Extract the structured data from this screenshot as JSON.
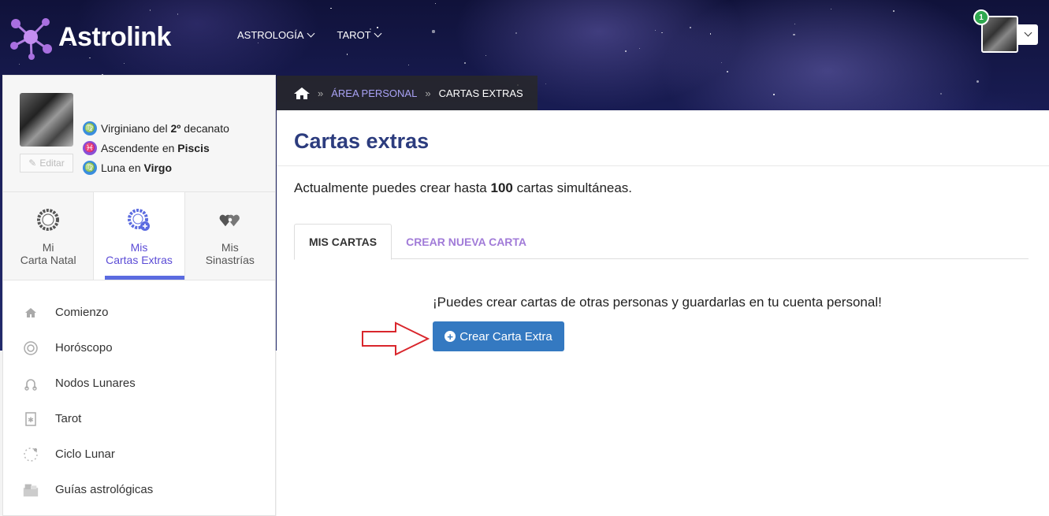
{
  "header": {
    "logo_text": "Astrolink",
    "nav": [
      {
        "label": "ASTROLOGÍA"
      },
      {
        "label": "TAROT"
      }
    ],
    "notification_count": "1"
  },
  "profile": {
    "edit_label": "Editar",
    "signs": [
      {
        "glyph": "♍",
        "prefix": "Virginiano del ",
        "strong": "2º",
        "suffix": " decanato",
        "color": "#3a8dde"
      },
      {
        "glyph": "♓",
        "prefix": "Ascendente en ",
        "strong": "Piscis",
        "suffix": "",
        "color": "#8a4fd6"
      },
      {
        "glyph": "♍",
        "prefix": "Luna en ",
        "strong": "Virgo",
        "suffix": "",
        "color": "#3a8dde"
      }
    ]
  },
  "sidebar_tabs": [
    {
      "line1": "Mi",
      "line2": "Carta Natal",
      "icon": "natal-chart-icon"
    },
    {
      "line1": "Mis",
      "line2": "Cartas Extras",
      "icon": "extra-charts-icon"
    },
    {
      "line1": "Mis",
      "line2": "Sinastrías",
      "icon": "hearts-icon"
    }
  ],
  "menu": [
    {
      "label": "Comienzo",
      "icon": "home-icon"
    },
    {
      "label": "Horóscopo",
      "icon": "horoscope-icon"
    },
    {
      "label": "Nodos Lunares",
      "icon": "lunar-nodes-icon"
    },
    {
      "label": "Tarot",
      "icon": "tarot-card-icon"
    },
    {
      "label": "Ciclo Lunar",
      "icon": "moon-cycle-icon"
    },
    {
      "label": "Guías astrológicas",
      "icon": "guides-icon"
    }
  ],
  "breadcrumb": {
    "link": "ÁREA PERSONAL",
    "current": "CARTAS EXTRAS"
  },
  "main": {
    "title": "Cartas extras",
    "desc_prefix": "Actualmente puedes crear hasta ",
    "desc_strong": "100",
    "desc_suffix": " cartas simultáneas.",
    "tabs": [
      {
        "label": "MIS CARTAS"
      },
      {
        "label": "CREAR NUEVA CARTA"
      }
    ],
    "promo": "¡Puedes crear cartas de otras personas y guardarlas en tu cuenta personal!",
    "create_button": "Crear Carta Extra"
  },
  "colors": {
    "accent": "#5b6be0",
    "title": "#2c3c7e",
    "button": "#3479c1",
    "arrow": "#d9262c"
  }
}
